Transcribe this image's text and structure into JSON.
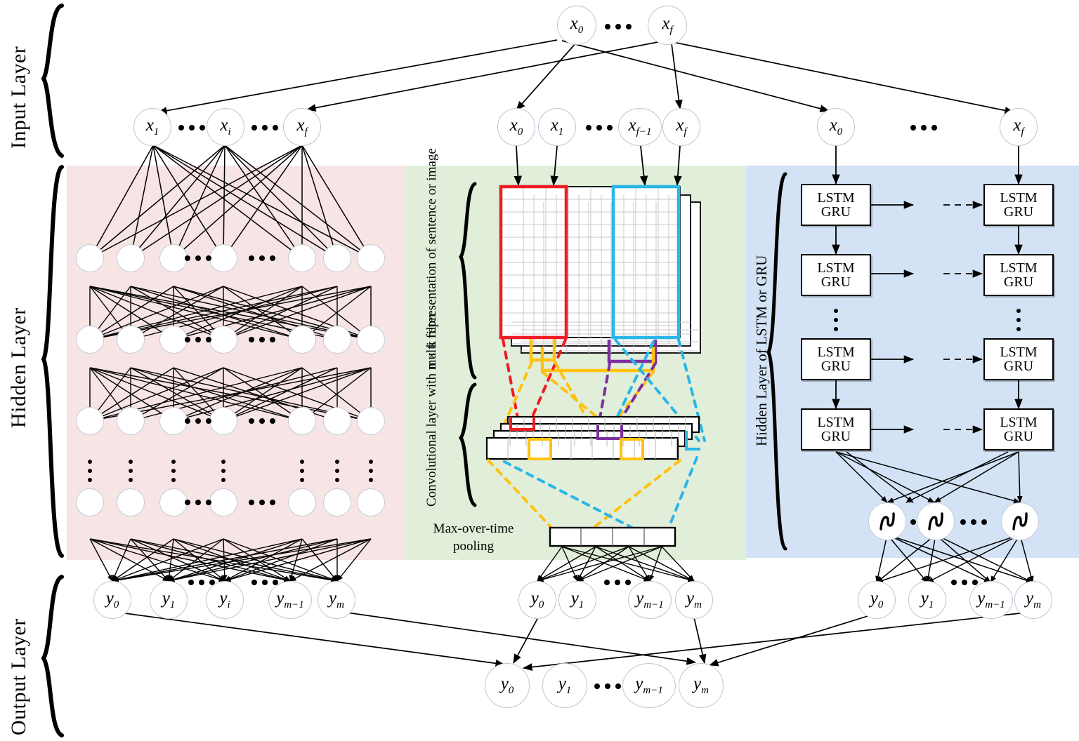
{
  "figure": {
    "type": "neural-network-architecture-diagram",
    "title_visible": false
  },
  "side_labels": {
    "input": "Input Layer",
    "hidden": "Hidden Layer",
    "output": "Output Layer"
  },
  "colors": {
    "dnn_region": "#f7e4e4",
    "cnn_region": "#e1eed9",
    "rnn_region": "#d3e3f5",
    "filter_red": "#ee1c25",
    "filter_cyan": "#29b6e8",
    "filter_yellow": "#ffc20e",
    "filter_purple": "#7b2fa0",
    "stroke": "#000000"
  },
  "top_input": {
    "nodes": [
      "x_0",
      "x_f"
    ],
    "labels": [
      "x",
      "x"
    ],
    "subs": [
      "0",
      "f"
    ],
    "ellipsis": "•••"
  },
  "dnn": {
    "input_nodes": [
      {
        "base": "x",
        "sub": "1"
      },
      {
        "base": "x",
        "sub": "i"
      },
      {
        "base": "x",
        "sub": "f"
      }
    ],
    "hidden_rows": 4,
    "hidden_nodes_per_row": 7,
    "row_ellipsis_positions": [
      3,
      5
    ],
    "vertical_dots_row": true,
    "output_nodes": [
      {
        "base": "y",
        "sub": "0"
      },
      {
        "base": "y",
        "sub": "1"
      },
      {
        "base": "y",
        "sub": "i"
      },
      {
        "base": "y",
        "sub": "m−1"
      },
      {
        "base": "y",
        "sub": "m"
      }
    ]
  },
  "cnn": {
    "input_nodes": [
      {
        "base": "x",
        "sub": "0"
      },
      {
        "base": "x",
        "sub": "1"
      },
      {
        "base": "x",
        "sub": "f−1"
      },
      {
        "base": "x",
        "sub": "f"
      }
    ],
    "section_labels": {
      "matrix": "n×k representation of sentence or image",
      "conv": "Convolutional layer with multi filter",
      "pool": "Max-over-time pooling"
    },
    "matrix": {
      "cols": 8,
      "rows": 12,
      "sheets": 3
    },
    "conv_bars": 4,
    "pool_cells": 4,
    "output_nodes": [
      {
        "base": "y",
        "sub": "0"
      },
      {
        "base": "y",
        "sub": "1"
      },
      {
        "base": "y",
        "sub": "m−1"
      },
      {
        "base": "y",
        "sub": "m"
      }
    ]
  },
  "rnn": {
    "input_nodes": [
      {
        "base": "x",
        "sub": "0"
      },
      {
        "base": "x",
        "sub": "f"
      }
    ],
    "section_label": "Hidden Layer of LSTM or GRU",
    "cell_lines": [
      "LSTM",
      "GRU"
    ],
    "cell_rows": 4,
    "cell_cols": 2,
    "vertical_dots_after_row": 2,
    "activation_icon": "sigmoid-curve",
    "activation_count": 3,
    "output_nodes": [
      {
        "base": "y",
        "sub": "0"
      },
      {
        "base": "y",
        "sub": "1"
      },
      {
        "base": "y",
        "sub": "m−1"
      },
      {
        "base": "y",
        "sub": "m"
      }
    ]
  },
  "final_output": {
    "nodes": [
      {
        "base": "y",
        "sub": "0"
      },
      {
        "base": "y",
        "sub": "1"
      },
      {
        "base": "y",
        "sub": "m−1"
      },
      {
        "base": "y",
        "sub": "m"
      }
    ],
    "ellipsis": "•••"
  }
}
